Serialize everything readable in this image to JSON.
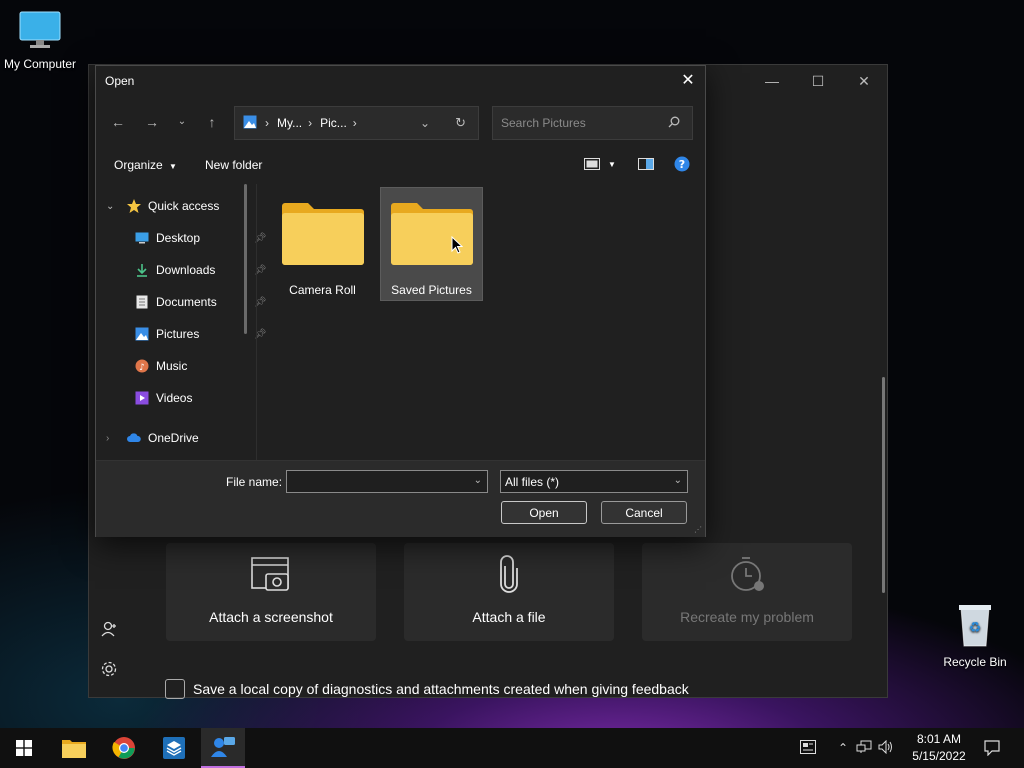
{
  "desktop": {
    "icons": [
      {
        "label": "My Computer"
      },
      {
        "label": "Recycle Bin"
      }
    ]
  },
  "background_window": {
    "cards": [
      {
        "label": "Attach a screenshot"
      },
      {
        "label": "Attach a file"
      },
      {
        "label": "Recreate my problem"
      }
    ],
    "save_copy_label": "Save a local copy of diagnostics and attachments created when giving feedback"
  },
  "dialog": {
    "title": "Open",
    "breadcrumb": [
      "My...",
      "Pic..."
    ],
    "search_placeholder": "Search Pictures",
    "toolbar": {
      "organize": "Organize",
      "new_folder": "New folder"
    },
    "nav": {
      "quick_access": "Quick access",
      "items": [
        "Desktop",
        "Downloads",
        "Documents",
        "Pictures",
        "Music",
        "Videos"
      ],
      "onedrive": "OneDrive"
    },
    "folders": [
      "Camera Roll",
      "Saved Pictures"
    ],
    "file_name_label": "File name:",
    "file_name_value": "",
    "file_type": "All files (*)",
    "open_label": "Open",
    "cancel_label": "Cancel"
  },
  "taskbar": {
    "time": "8:01 AM",
    "date": "5/15/2022"
  },
  "colors": {
    "accent": "#c06fe0",
    "folder_yellow": "#f5c542",
    "help_blue": "#2f86e8"
  }
}
